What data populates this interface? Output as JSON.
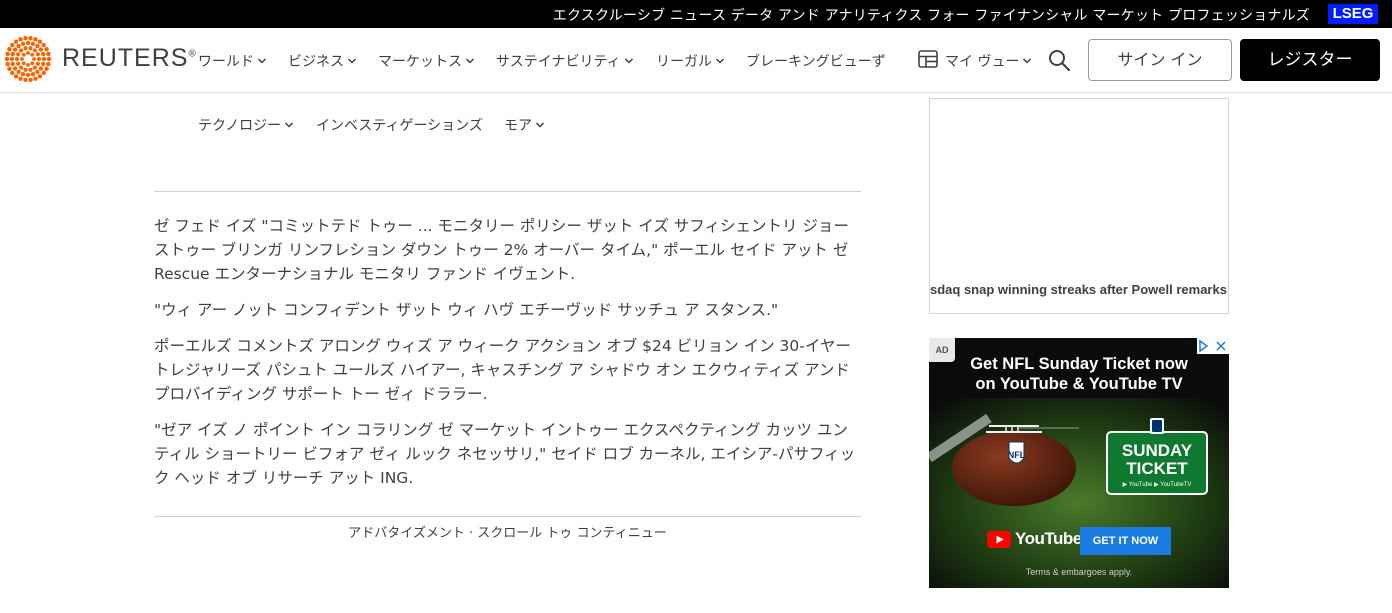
{
  "banner": {
    "promo_text": "エクスクルーシブ ニュース データ アンド アナリティクス フォー ファイナンシャル マーケット プロフェッショナルズ",
    "lseg_label": "LSEG",
    "lseg_color": "#001EFF"
  },
  "header": {
    "brand": "REUTERS",
    "brand_mark": "®",
    "nav": [
      {
        "label": "ワールド",
        "has_menu": true
      },
      {
        "label": "ビジネス",
        "has_menu": true
      },
      {
        "label": "マーケットス",
        "has_menu": true
      },
      {
        "label": "サステイナビリティ",
        "has_menu": true
      },
      {
        "label": "リーガル",
        "has_menu": true
      },
      {
        "label": "ブレーキングビューず",
        "has_menu": false
      }
    ],
    "my_view_label": "マイ ヴュー",
    "sign_in_label": "サイン イン",
    "register_label": "レジスター",
    "logo_color": "#FA6400"
  },
  "nav_row2": [
    {
      "label": "テクノロジー",
      "has_menu": true
    },
    {
      "label": "インベスティゲーションズ",
      "has_menu": false
    },
    {
      "label": "モア",
      "has_menu": true
    }
  ],
  "article": {
    "paragraphs": [
      "ゼ フェド イズ \"コミットテド トゥー ... モニタリー ポリシー ザット イズ サフィシェントリ ジョーストゥー ブリンガ リンフレション ダウン トゥー 2% オーバー タイム,\" ポーエル セイド アット ゼ Rescue エンターナショナル モニタリ ファンド イヴェント.",
      "\"ウィ アー ノット コンフィデント ザット ウィ ハヴ エチーヴッド サッチュ ア スタンス.\"",
      "ポーエルズ コメントズ アロング ウィズ ア ウィーク アクション オブ $24 ビリョン イン 30-イヤー トレジャリーズ パシュト ユールズ ハイアー, キャスチング ア シャドウ オン エクウィティズ アンド プロバイディング サポート トー ゼィ ドララー.",
      "\"ゼア イズ ノ ポイント イン コラリング ゼ マーケット イントゥー エクスペクティング カッツ ユンティル ショートリー ビフォア ゼィ ルック ネセッサリ,\" セイド ロブ カーネル, エイシア-パサフィック ヘッド オブ リサーチ アット ING."
    ],
    "advertisement_scroll": "アドバタイズメント · スクロール トゥ コンティニュー"
  },
  "rail": {
    "headline_fragment": "sdaq snap winning streaks after Powell remarks"
  },
  "ad": {
    "badge": "AD",
    "headline_line1": "Get NFL Sunday Ticket now",
    "headline_line2": "on YouTube & YouTube TV",
    "ball_logo": "NFL",
    "ticket_line1": "SUNDAY",
    "ticket_line2": "TICKET",
    "ticket_sub": "▶ YouTube  ▶ YouTubeTV",
    "youtube_label": "YouTube",
    "cta_label": "GET IT NOW",
    "terms": "Terms & embargoes apply.",
    "cta_color": "#1A7BE2"
  }
}
